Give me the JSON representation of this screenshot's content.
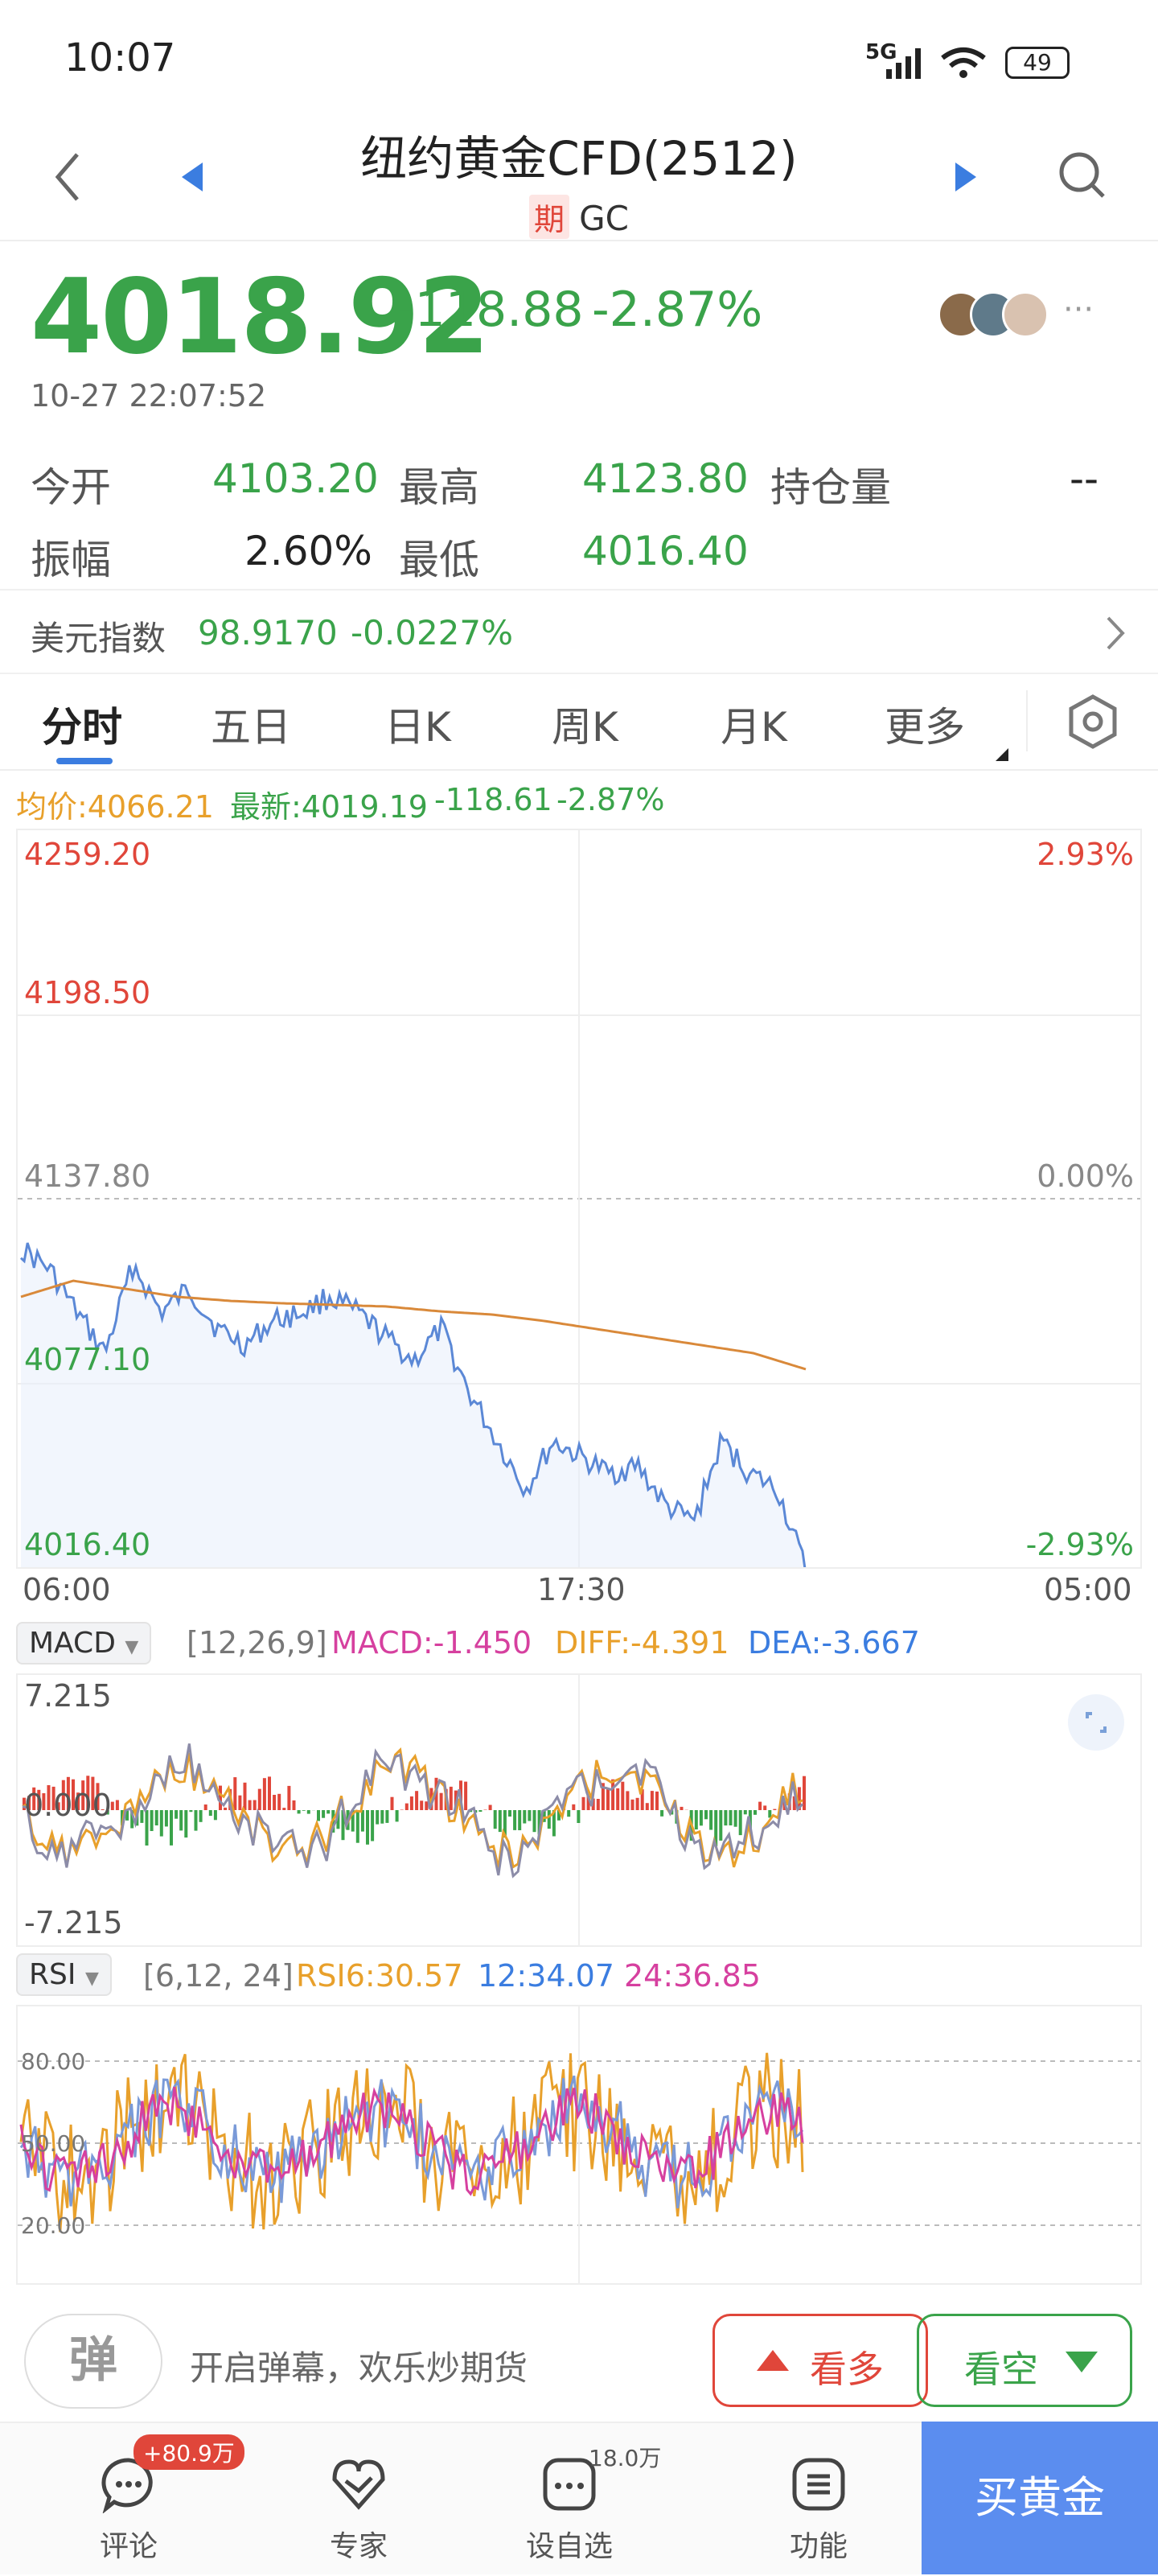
{
  "status_bar": {
    "time": "10:07",
    "network": "5G",
    "battery": "49"
  },
  "header": {
    "title": "纽约黄金CFD(2512)",
    "badge": "期",
    "code": "GC"
  },
  "quote": {
    "price": "4018.92",
    "change": "-118.88",
    "change_pct": "-2.87%",
    "timestamp": "10-27 22:07:52",
    "more": "···"
  },
  "stats": {
    "open_label": "今开",
    "open": "4103.20",
    "high_label": "最高",
    "high": "4123.80",
    "oi_label": "持仓量",
    "oi": "--",
    "amp_label": "振幅",
    "amp": "2.60%",
    "low_label": "最低",
    "low": "4016.40"
  },
  "dxy": {
    "label": "美元指数",
    "value": "98.9170",
    "change": "-0.0227%"
  },
  "tabs": [
    "分时",
    "五日",
    "日K",
    "周K",
    "月K",
    "更多"
  ],
  "intraday": {
    "avg_label": "均价:4066.21",
    "latest_label": "最新:4019.19",
    "latest_change": "-118.61",
    "latest_pct": "-2.87%",
    "y_left": [
      "4259.20",
      "4198.50",
      "4137.80",
      "4077.10",
      "4016.40"
    ],
    "y_right": [
      "2.93%",
      "0.00%",
      "-2.93%"
    ],
    "x_labels": [
      "06:00",
      "17:30",
      "05:00"
    ]
  },
  "macd": {
    "selector": "MACD",
    "params": "[12,26,9]",
    "macd": "MACD:-1.450",
    "diff": "DIFF:-4.391",
    "dea": "DEA:-3.667",
    "y_top": "7.215",
    "y_mid": "0.000",
    "y_bot": "-7.215"
  },
  "rsi": {
    "selector": "RSI",
    "params": "[6,12, 24]",
    "rsi6": "RSI6:30.57",
    "rsi12": "12:34.07",
    "rsi24": "24:36.85",
    "levels": [
      "80.00",
      "50.00",
      "20.00"
    ]
  },
  "actions": {
    "danmu_icon": "弹",
    "danmu_text": "开启弹幕，欢乐炒期货",
    "bull": "看多",
    "bear": "看空"
  },
  "bottom_nav": {
    "comment": "评论",
    "comment_badge": "+80.9万",
    "expert": "专家",
    "watch": "设自选",
    "watch_count": "18.0万",
    "func": "功能",
    "buy": "买黄金"
  },
  "colors": {
    "green": "#3aa34a",
    "red": "#e0463a",
    "blue": "#3b7de0",
    "orange": "#e8a02b",
    "magenta": "#d6409f"
  }
}
